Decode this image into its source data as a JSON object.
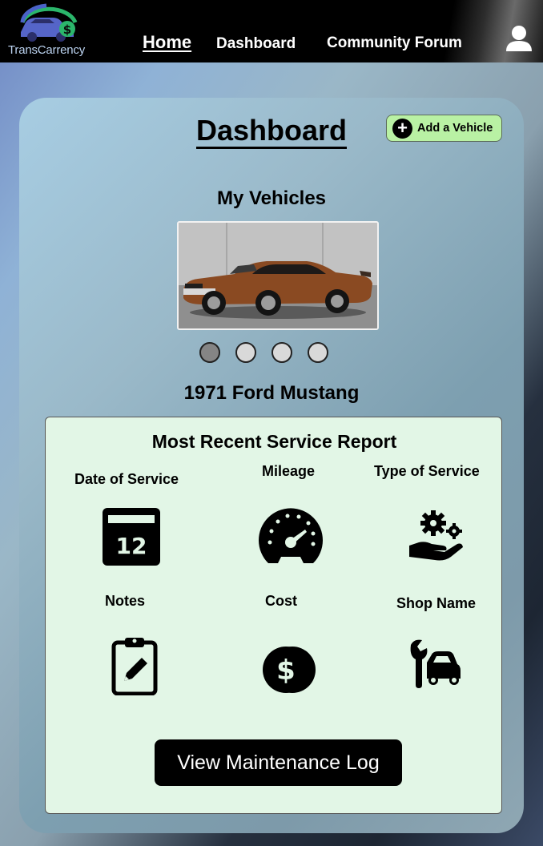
{
  "app": {
    "logo_text": "TransCarrency"
  },
  "nav": {
    "home_label": "Home",
    "dashboard_label": "Dashboard",
    "forum_label": "Community Forum"
  },
  "dashboard": {
    "title": "Dashboard",
    "add_vehicle_label": "Add a Vehicle",
    "my_vehicles_title": "My Vehicles",
    "vehicle_name": "1971 Ford Mustang",
    "carousel": {
      "count": 4,
      "active_index": 0
    }
  },
  "report": {
    "title": "Most Recent Service Report",
    "fields": {
      "date": "Date of Service",
      "mileage": "Mileage",
      "type": "Type of Service",
      "notes": "Notes",
      "cost": "Cost",
      "shop": "Shop Name"
    },
    "calendar_day": "12",
    "view_log_label": "View Maintenance Log"
  },
  "colors": {
    "accent_green": "#b9f1a4",
    "report_bg": "#e2f6e6",
    "navbar_bg": "#000000",
    "car_color": "#8a4a22"
  },
  "icons": [
    "car-logo-icon",
    "user-icon",
    "plus-icon",
    "calendar-icon",
    "speedometer-icon",
    "gear-hand-icon",
    "clipboard-pencil-icon",
    "dollar-coin-icon",
    "wrench-car-icon"
  ]
}
